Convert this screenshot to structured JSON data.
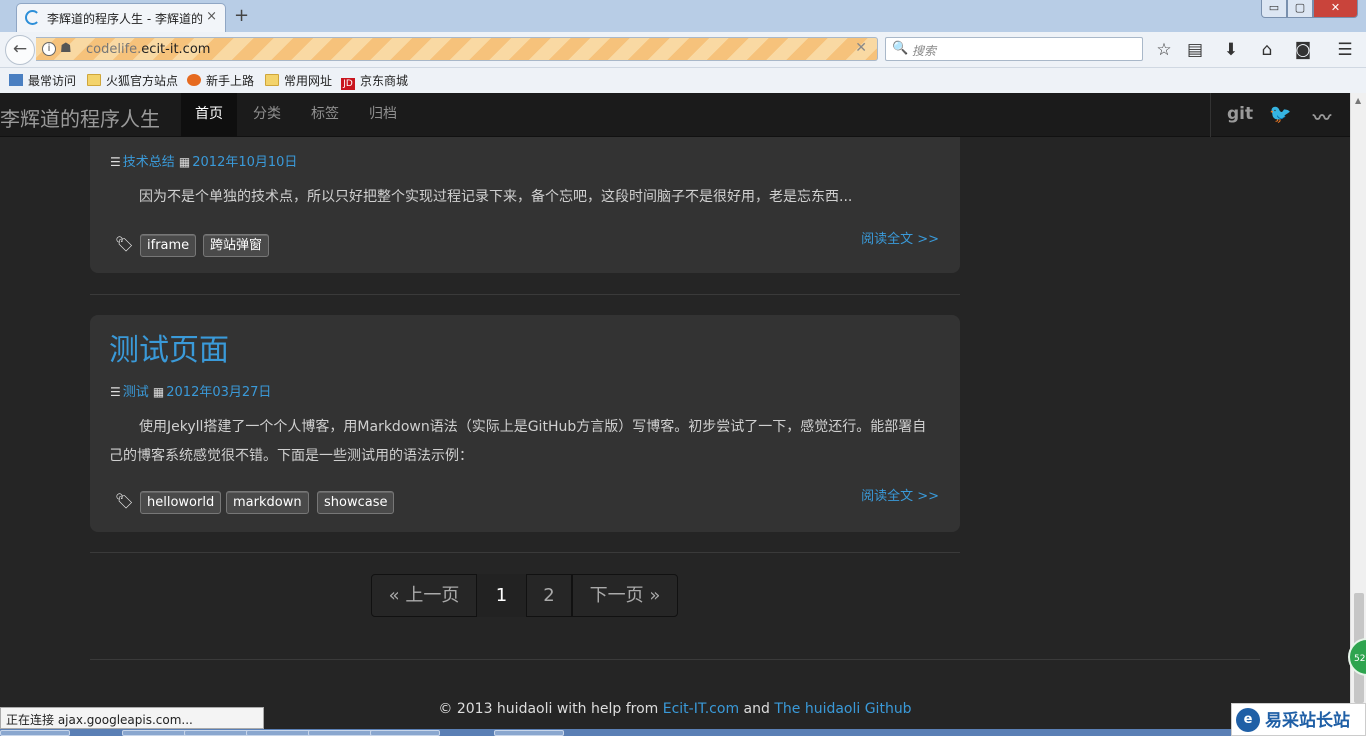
{
  "browser": {
    "tab_title": "李辉道的程序人生 - 李辉道的",
    "tab_close": "×",
    "new_tab": "+",
    "window_buttons": {
      "minimize": "▭",
      "maximize": "▢",
      "close": "✕"
    },
    "url_prefix": "codelife.",
    "url_domain": "ecit-it.com",
    "url_clear": "✕",
    "search_placeholder": "搜索",
    "icons": [
      "back-icon",
      "info-icon",
      "mask-icon",
      "search-icon",
      "star-icon",
      "reading-list-icon",
      "download-icon",
      "home-icon",
      "pocket-icon",
      "menu-icon"
    ]
  },
  "bookmarks": [
    {
      "label": "最常访问",
      "icon": "blue"
    },
    {
      "label": "火狐官方站点",
      "icon": "folder"
    },
    {
      "label": "新手上路",
      "icon": "fox"
    },
    {
      "label": "常用网址",
      "icon": "folder"
    },
    {
      "label": "京东商城",
      "icon": "jd",
      "badge": "JD"
    }
  ],
  "site": {
    "brand": "李辉道的程序人生",
    "nav": [
      {
        "label": "首页",
        "active": true
      },
      {
        "label": "分类",
        "active": false
      },
      {
        "label": "标签",
        "active": false
      },
      {
        "label": "归档",
        "active": false
      }
    ],
    "social": {
      "git": "git",
      "twitter": "🐦",
      "rss": "〰"
    }
  },
  "posts": [
    {
      "title": "",
      "category": "技术总结",
      "date": "2012年10月10日",
      "excerpt": "因为不是个单独的技术点，所以只好把整个实现过程记录下来，备个忘吧，这段时间脑子不是很好用，老是忘东西...",
      "tags": [
        "iframe",
        "跨站弹窗"
      ],
      "read_more": "阅读全文 >>"
    },
    {
      "title": "测试页面",
      "category": "测试",
      "date": "2012年03月27日",
      "excerpt": "使用Jekyll搭建了一个个人博客，用Markdown语法（实际上是GitHub方言版）写博客。初步尝试了一下，感觉还行。能部署自己的博客系统感觉很不错。下面是一些测试用的语法示例：",
      "tags": [
        "helloworld",
        "markdown",
        "showcase"
      ],
      "read_more": "阅读全文 >>"
    }
  ],
  "pager": {
    "prev": "« 上一页",
    "page1": "1",
    "page2": "2",
    "next": "下一页 »"
  },
  "footer": {
    "prefix": "© 2013 huidaoli with help from ",
    "link1": "Ecit-IT.com",
    "middle": " and ",
    "link2": "The huidaoli Github"
  },
  "status_text": "正在连接 ajax.googleapis.com...",
  "watermark": {
    "text": "易采站长站",
    "logo": "e"
  },
  "badge": "52",
  "colors": {
    "link": "#3a9ad9",
    "page_bg": "#252525",
    "card_bg": "#333333",
    "nav_bg": "#1b1b1b"
  }
}
